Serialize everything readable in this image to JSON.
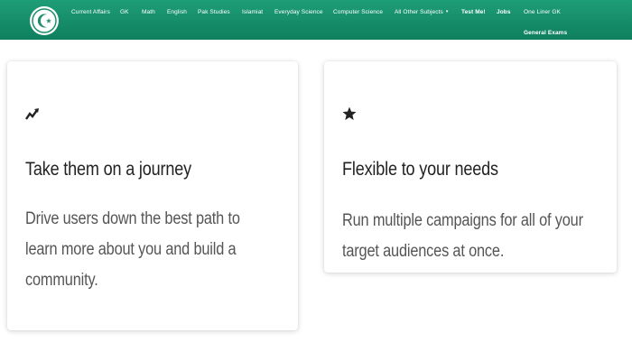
{
  "navbar": {
    "brand_icon": "crescent-star-logo-icon",
    "links": [
      {
        "label": "Current Affairs"
      },
      {
        "label": "GK"
      },
      {
        "label": "Math"
      },
      {
        "label": "English"
      },
      {
        "label": "Pak Studies"
      },
      {
        "label": "Islamiat"
      },
      {
        "label": "Everyday Science"
      },
      {
        "label": "Computer Science"
      },
      {
        "label": "All Other Subjects"
      },
      {
        "label": "Test Me!"
      },
      {
        "label": "Jobs"
      },
      {
        "label": "One Liner GK"
      },
      {
        "label": "General Exams"
      }
    ],
    "dropdown_caret": "▾"
  },
  "cards": [
    {
      "icon": "trend-arrow-icon",
      "title": "Take them on a journey",
      "text": "Drive users down the best path to learn more about you and build a community."
    },
    {
      "icon": "star-icon",
      "title": "Flexible to your needs",
      "text": "Run multiple campaigns for all of your target audiences at once."
    }
  ],
  "colors": {
    "navbar_top": "#1e9e76",
    "navbar_bottom": "#0f7f5e",
    "title": "#222222",
    "text": "#555555"
  }
}
